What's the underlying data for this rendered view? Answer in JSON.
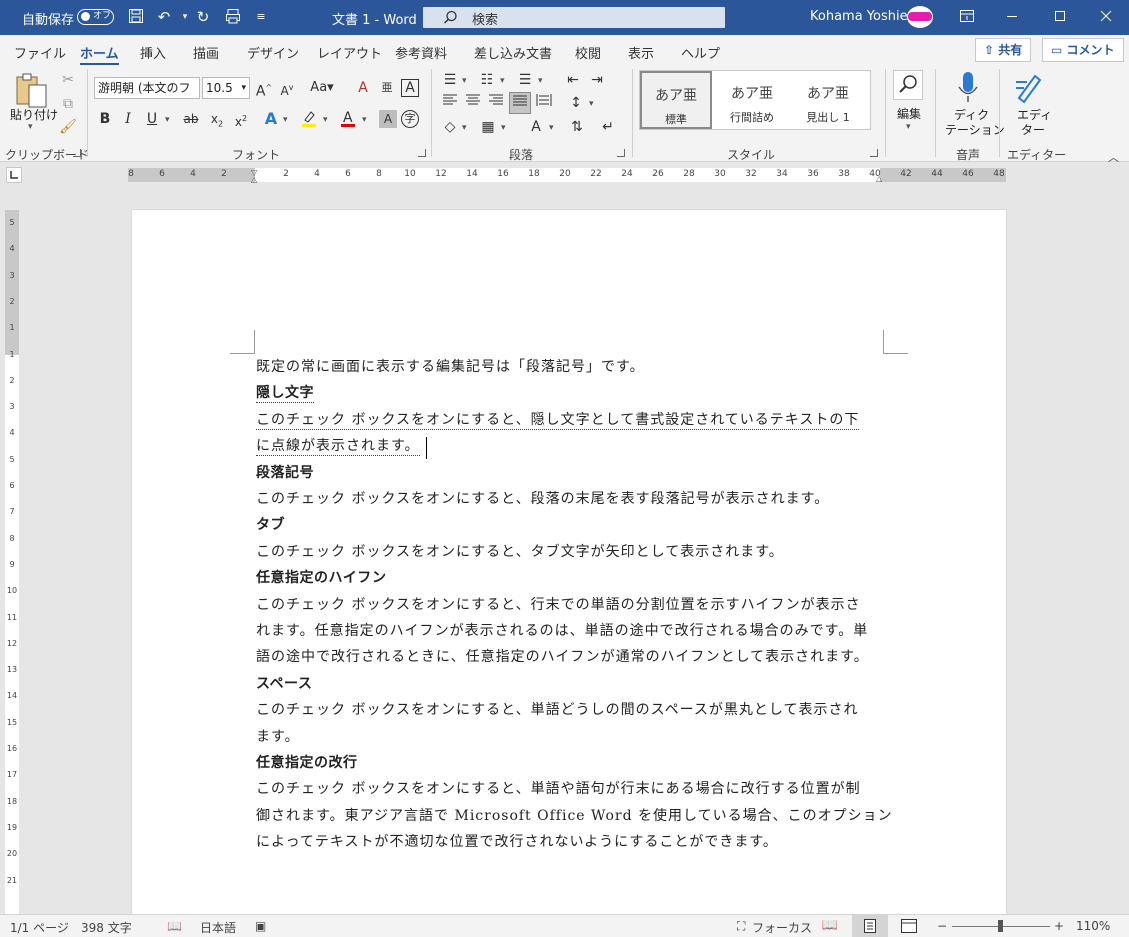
{
  "titlebar": {
    "autosave_label": "自動保存",
    "autosave_state": "オフ",
    "document_title": "文書 1  -  Word",
    "search_placeholder": "検索",
    "user_name": "Kohama Yoshie",
    "accent": "#2b579a"
  },
  "tabs": [
    "ファイル",
    "ホーム",
    "挿入",
    "描画",
    "デザイン",
    "レイアウト",
    "参考資料",
    "差し込み文書",
    "校閲",
    "表示",
    "ヘルプ"
  ],
  "active_tab": "ホーム",
  "share_label": "共有",
  "comment_label": "コメント",
  "ribbon": {
    "clipboard": {
      "paste_label": "貼り付け",
      "group_label": "クリップボード"
    },
    "font": {
      "font_name": "游明朝 (本文のフ",
      "font_size": "10.5",
      "group_label": "フォント",
      "case_label": "Aa"
    },
    "paragraph": {
      "group_label": "段落"
    },
    "styles": {
      "group_label": "スタイル",
      "items": [
        {
          "preview": "あア亜",
          "name": "標準"
        },
        {
          "preview": "あア亜",
          "name": "行間詰め"
        },
        {
          "preview": "あア亜",
          "name": "見出し 1"
        }
      ]
    },
    "editing": {
      "label": "編集"
    },
    "voice": {
      "label1": "ディク",
      "label2": "テーション",
      "group_label": "音声"
    },
    "editor": {
      "label1": "エディ",
      "label2": "ター",
      "group_label": "エディター"
    }
  },
  "ruler": {
    "h_ticks": [
      "8",
      "6",
      "4",
      "2",
      "2",
      "4",
      "6",
      "8",
      "10",
      "12",
      "14",
      "16",
      "18",
      "20",
      "22",
      "24",
      "26",
      "28",
      "30",
      "32",
      "34",
      "36",
      "38",
      "40",
      "42",
      "44",
      "46",
      "48"
    ],
    "v_ticks": [
      "5",
      "4",
      "3",
      "2",
      "1",
      "1",
      "2",
      "3",
      "4",
      "5",
      "6",
      "7",
      "8",
      "9",
      "10",
      "11",
      "12",
      "13",
      "14",
      "15",
      "16",
      "17",
      "18",
      "19",
      "20",
      "21"
    ]
  },
  "document": {
    "lines": [
      {
        "text": "既定の常に画面に表示する編集記号は「段落記号」です。",
        "kind": "body"
      },
      {
        "text": "隠し文字",
        "kind": "heading-hidden"
      },
      {
        "text": "このチェック ボックスをオンにすると、隠し文字として書式設定されているテキストの下",
        "kind": "hidden"
      },
      {
        "text": "に点線が表示されます。",
        "kind": "hidden"
      },
      {
        "text": "段落記号",
        "kind": "heading"
      },
      {
        "text": "このチェック ボックスをオンにすると、段落の末尾を表す段落記号が表示されます。",
        "kind": "body"
      },
      {
        "text": "タブ",
        "kind": "heading"
      },
      {
        "text": "このチェック ボックスをオンにすると、タブ文字が矢印として表示されます。",
        "kind": "body"
      },
      {
        "text": "任意指定のハイフン",
        "kind": "heading"
      },
      {
        "text": "このチェック ボックスをオンにすると、行末での単語の分割位置を示すハイフンが表示さ",
        "kind": "body"
      },
      {
        "text": "れます。任意指定のハイフンが表示されるのは、単語の途中で改行される場合のみです。単",
        "kind": "body"
      },
      {
        "text": "語の途中で改行されるときに、任意指定のハイフンが通常のハイフンとして表示されます。",
        "kind": "body"
      },
      {
        "text": "スペース",
        "kind": "heading"
      },
      {
        "text": "このチェック ボックスをオンにすると、単語どうしの間のスペースが黒丸として表示され",
        "kind": "body"
      },
      {
        "text": "ます。",
        "kind": "body"
      },
      {
        "text": "任意指定の改行",
        "kind": "heading"
      },
      {
        "text": "このチェック ボックスをオンにすると、単語や語句が行末にある場合に改行する位置が制",
        "kind": "body"
      },
      {
        "text": "御されます。東アジア言語で Microsoft Office Word を使用している場合、このオプション",
        "kind": "body"
      },
      {
        "text": "によってテキストが不適切な位置で改行されないようにすることができます。",
        "kind": "body"
      }
    ]
  },
  "status": {
    "page": "1/1 ページ",
    "words": "398 文字",
    "language": "日本語",
    "focus": "フォーカス",
    "zoom": "110%",
    "minus": "−",
    "plus": "+"
  }
}
